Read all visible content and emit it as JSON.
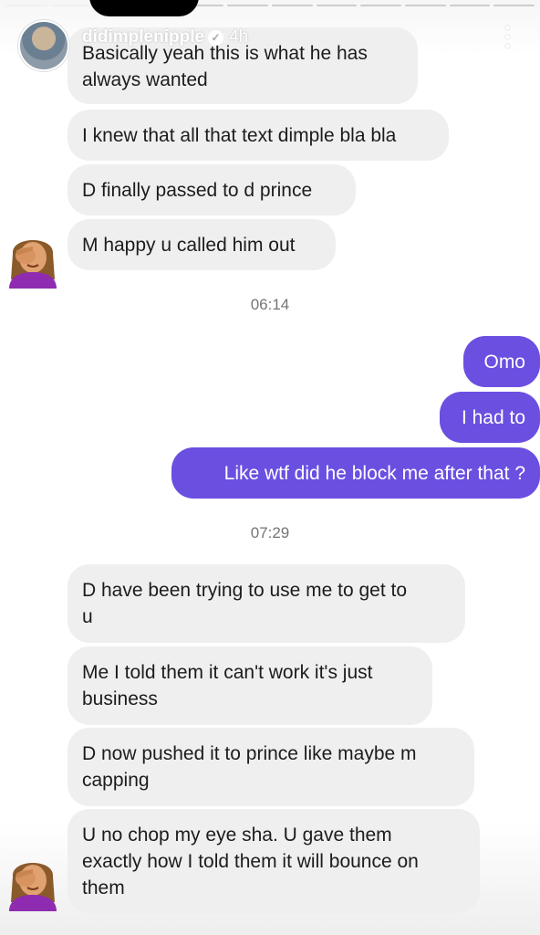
{
  "story": {
    "username": "didimplenipple",
    "time_ago": "4h"
  },
  "chat": {
    "messages_group_1": [
      "Basically yeah this is what he has",
      "always wanted",
      "I knew that all that text dimple bla bla",
      "D finally passed to d prince",
      "M happy u called him out"
    ],
    "timestamp_1": "06:14",
    "sent": [
      "Omo",
      "I had to",
      "Like wtf did he block me after that ?"
    ],
    "timestamp_2": "07:29",
    "messages_group_2": [
      "D have been trying to use me to get to",
      "u",
      "Me I told them it can't work it's just",
      "business",
      "D now pushed it to prince like maybe m",
      "capping",
      "U no chop my eye sha. U gave them",
      "exactly how I told them it will bounce on",
      "them"
    ]
  },
  "colors": {
    "received_bubble": "#efefef",
    "sent_bubble": "#6b4fe0",
    "timestamp_text": "#757575"
  }
}
